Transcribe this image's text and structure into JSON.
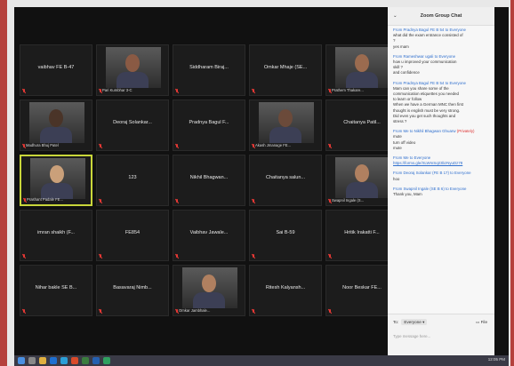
{
  "chat": {
    "title": "Zoom Group Chat",
    "minimize": "⌄",
    "messages": [
      {
        "from": "From Pradnya Bagul FE B 54 to Everyone",
        "lines": [
          "what did the exam entrance consisted of",
          "?",
          "yes mam"
        ]
      },
      {
        "from": "From Rameshwar ugali to Everyone",
        "lines": [
          "how u improved your communication",
          "skill ?",
          "and confidence"
        ]
      },
      {
        "from": "From Pradnya Bagul FE B 54 to Everyone",
        "lines": [
          "Mam can you share some of the",
          "communication etiquettes you needed",
          "to learn or follow",
          "When we have a German MNC then first",
          "thought is english must be very strong.",
          "Did even you get such thoughts and",
          "stress ?"
        ]
      },
      {
        "from": "From Me to Nikhil Bhagwan Ghuarw",
        "private": "(Privately)",
        "lines": [
          "mute",
          "turn off video",
          "mute"
        ]
      },
      {
        "from": "From Me to Everyone",
        "link": "https://forms.gle/XLWmSq23bzNyuDz78"
      },
      {
        "from": "From Deoraj Solankar (FE B 17) to Everyone",
        "lines": [
          "hoo"
        ]
      },
      {
        "from": "From Swapnil Ingale (SE B 6) to Everyone",
        "lines": [
          "Thank you, Mam"
        ]
      }
    ],
    "to_label": "To:",
    "to_value": "Everyone ▾",
    "file_label": "File",
    "input_placeholder": "Type message here..."
  },
  "tiles": [
    {
      "name": "vaibhav FE B-47",
      "video": false
    },
    {
      "name": "Pari Kumbhar 3-C",
      "video": true
    },
    {
      "name": "Siddharam Biraj...",
      "video": false
    },
    {
      "name": "Omkar Mhaje (SE...",
      "video": false
    },
    {
      "name": "Prathem Thakare...",
      "video": true
    },
    {
      "name": "Madhura Bhuj Patel",
      "video": true
    },
    {
      "name": "Deoraj Solankar...",
      "video": false
    },
    {
      "name": "Pradnya Bagul F...",
      "video": false
    },
    {
      "name": "Akash Jmanage FE...",
      "video": true
    },
    {
      "name": "Chaitanya Patil...",
      "video": false
    },
    {
      "name": "Prashant Padale FE...",
      "video": true
    },
    {
      "name": "123",
      "video": false
    },
    {
      "name": "Nikhil Bhagwan...",
      "video": false
    },
    {
      "name": "Chaitanya salun...",
      "video": false
    },
    {
      "name": "Swapnil Ingale (S...",
      "video": true
    },
    {
      "name": "imran shaikh (F...",
      "video": false
    },
    {
      "name": "FE854",
      "video": false
    },
    {
      "name": "Vaibhav Jawale...",
      "video": false
    },
    {
      "name": "Sai B-59",
      "video": false
    },
    {
      "name": "Hritik Irakatti F...",
      "video": false
    },
    {
      "name": "Nihar bakle SE B...",
      "video": false
    },
    {
      "name": "Basavaraj Nimb...",
      "video": false
    },
    {
      "name": "Omkar Jambhale...",
      "video": true
    },
    {
      "name": "Ritesh Kalyansh...",
      "video": false
    },
    {
      "name": "Noor Beskar FE...",
      "video": false
    }
  ],
  "taskbar": {
    "clock": "12:05 PM"
  },
  "colors": {
    "accent": "#c9d63a",
    "mute_red": "#e53935",
    "link_blue": "#2f6fce"
  }
}
